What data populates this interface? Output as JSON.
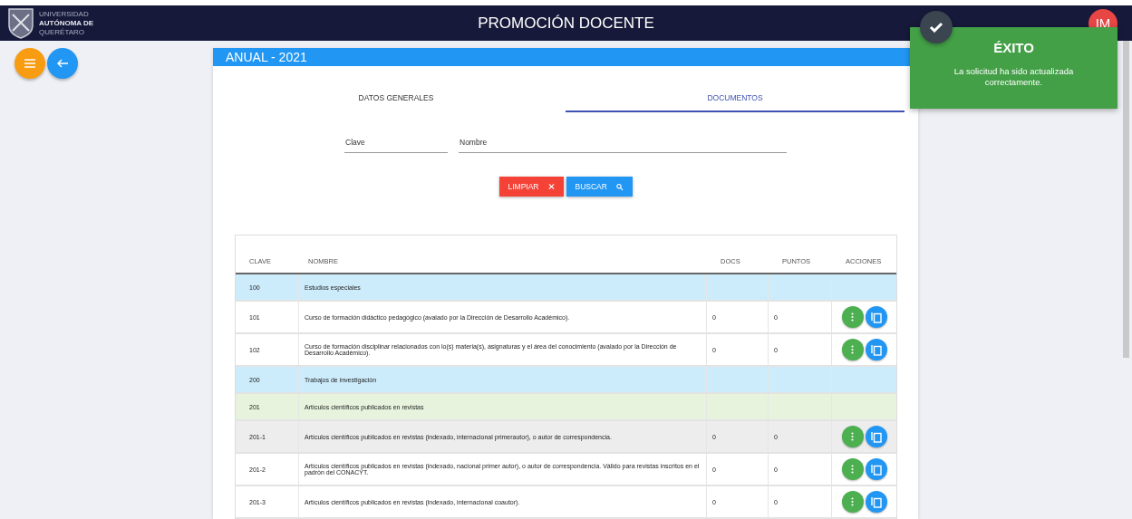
{
  "header": {
    "logo_lines": [
      "UNIVERSIDAD",
      "AUTÓNOMA DE",
      "QUERÉTARO"
    ],
    "title": "PROMOCIÓN DOCENTE",
    "avatar": "IM"
  },
  "card": {
    "title": "ANUAL - 2021"
  },
  "tabs": [
    {
      "label": "DATOS GENERALES",
      "selected": false
    },
    {
      "label": "DOCUMENTOS",
      "selected": true
    }
  ],
  "filters": [
    {
      "placeholder": "Clave"
    },
    {
      "placeholder": "Nombre"
    }
  ],
  "buttons": [
    {
      "label": "LIMPIAR",
      "kind": "clear"
    },
    {
      "label": "BUSCAR",
      "kind": "search"
    }
  ],
  "table": {
    "columns": [
      "CLAVE",
      "NOMBRE",
      "DOCS",
      "PUNTOS",
      "ACCIONES"
    ],
    "rows": [
      {
        "kind": "section",
        "clave": "100",
        "nombre": "Estudios especiales"
      },
      {
        "kind": "item",
        "clave": "101",
        "nombre": "Curso de formación didáctico pedagógico (avalado por la Dirección de Desarrollo Académico).",
        "docs": "0",
        "puntos": "0",
        "highlighted": false
      },
      {
        "kind": "item",
        "clave": "102",
        "nombre": "Curso de formación disciplinar relacionados con lo(s) materia(s), asignaturas y el área del conocimiento (avalado por la Dirección de Desarrollo Académico).",
        "docs": "0",
        "puntos": "0",
        "highlighted": false
      },
      {
        "kind": "section",
        "clave": "200",
        "nombre": "Trabajos de investigación"
      },
      {
        "kind": "subsection",
        "clave": "201",
        "nombre": "Artículos científicos publicados en revistas"
      },
      {
        "kind": "item",
        "clave": "201-1",
        "nombre": "Artículos científicos publicados en revistas (indexado, internacional primerautor), o autor de correspondencia.",
        "docs": "0",
        "puntos": "0",
        "highlighted": true
      },
      {
        "kind": "item",
        "clave": "201-2",
        "nombre": "Artículos científicos publicados en revistas (indexado, nacional primer autor), o autor de correspondencia. Válido para revistas inscritos en el padrón del CONACYT.",
        "docs": "0",
        "puntos": "0",
        "highlighted": false
      },
      {
        "kind": "item",
        "clave": "201-3",
        "nombre": "Artículos científicos publicados en revistas (indexado, internacional coautor).",
        "docs": "0",
        "puntos": "0",
        "highlighted": false
      }
    ]
  },
  "toast": {
    "title": "ÉXITO",
    "message": "La solicitud ha sido actualizada correctamente."
  }
}
